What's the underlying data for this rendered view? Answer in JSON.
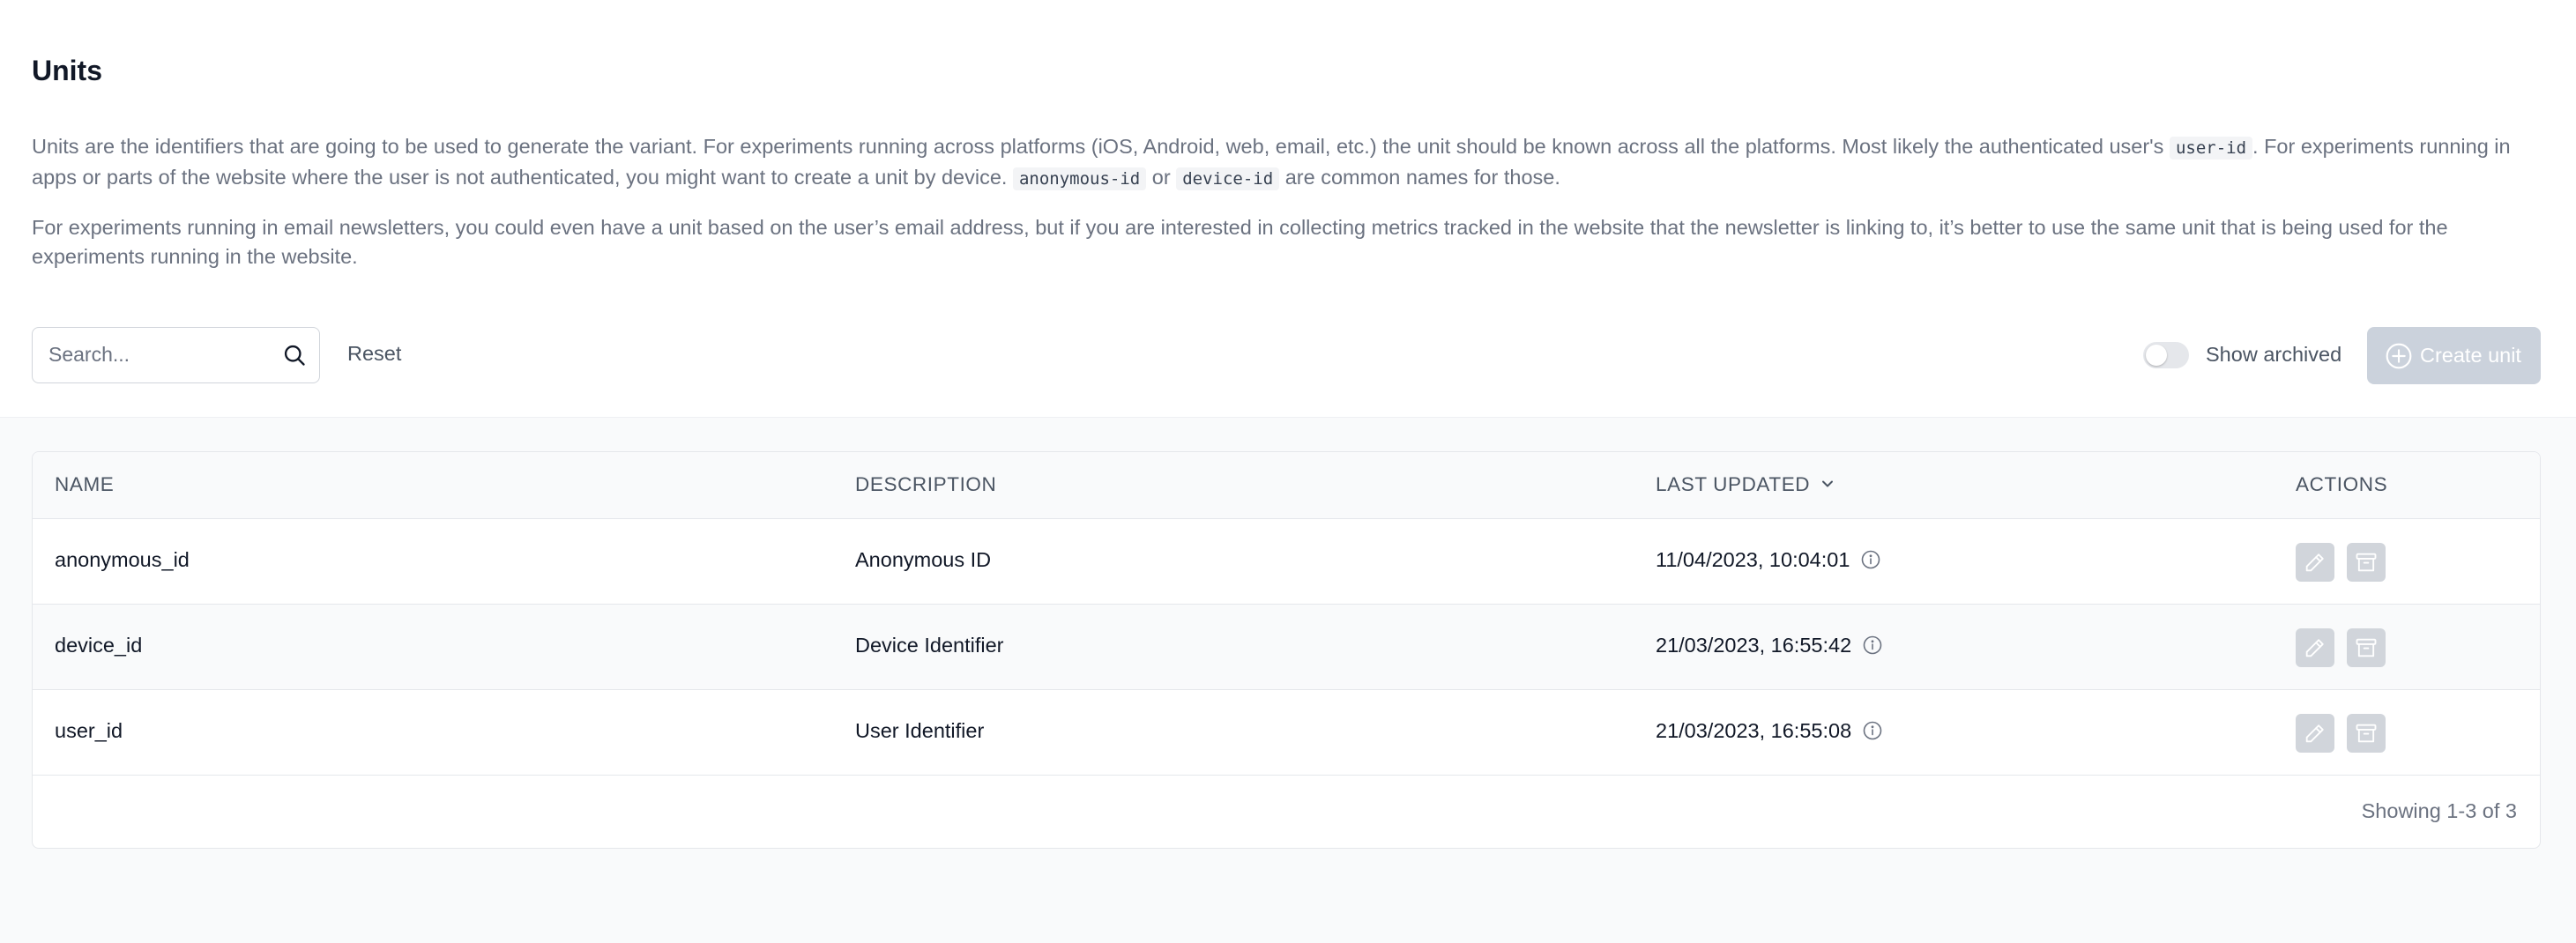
{
  "page": {
    "title": "Units",
    "description_1": {
      "text_a": "Units are the identifiers that are going to be used to generate the variant. For experiments running across platforms (iOS, Android, web, email, etc.) the unit should be known across all the platforms. Most likely the authenticated user's ",
      "code_a": "user-id",
      "text_b": ". For experiments running in apps or parts of the website where the user is not authenticated, you might want to create a unit by device. ",
      "code_b": "anonymous-id",
      "text_c": " or ",
      "code_c": "device-id",
      "text_d": " are common names for those."
    },
    "description_2": "For experiments running in email newsletters, you could even have a unit based on the user’s email address, but if you are interested in collecting metrics tracked in the website that the newsletter is linking to, it’s better to use the same unit that is being used for the experiments running in the website."
  },
  "toolbar": {
    "search_placeholder": "Search...",
    "search_value": "",
    "reset_label": "Reset",
    "show_archived_label": "Show archived",
    "show_archived_on": false,
    "create_label": "Create unit"
  },
  "table": {
    "columns": {
      "name": "NAME",
      "description": "DESCRIPTION",
      "last_updated": "LAST UPDATED",
      "actions": "ACTIONS"
    },
    "rows": [
      {
        "name": "anonymous_id",
        "description": "Anonymous ID",
        "last_updated": "11/04/2023, 10:04:01"
      },
      {
        "name": "device_id",
        "description": "Device Identifier",
        "last_updated": "21/03/2023, 16:55:42"
      },
      {
        "name": "user_id",
        "description": "User Identifier",
        "last_updated": "21/03/2023, 16:55:08"
      }
    ],
    "pagination": "Showing 1-3 of 3"
  },
  "icons": {
    "search": "search-icon",
    "create": "plus-circle-icon",
    "sort": "chevron-down-icon",
    "info": "info-icon",
    "edit": "pencil-icon",
    "archive": "archive-icon"
  },
  "colors": {
    "disabled_button": "#cbd2dc",
    "action_button": "#d1d5db",
    "muted_text": "#6b7280"
  }
}
